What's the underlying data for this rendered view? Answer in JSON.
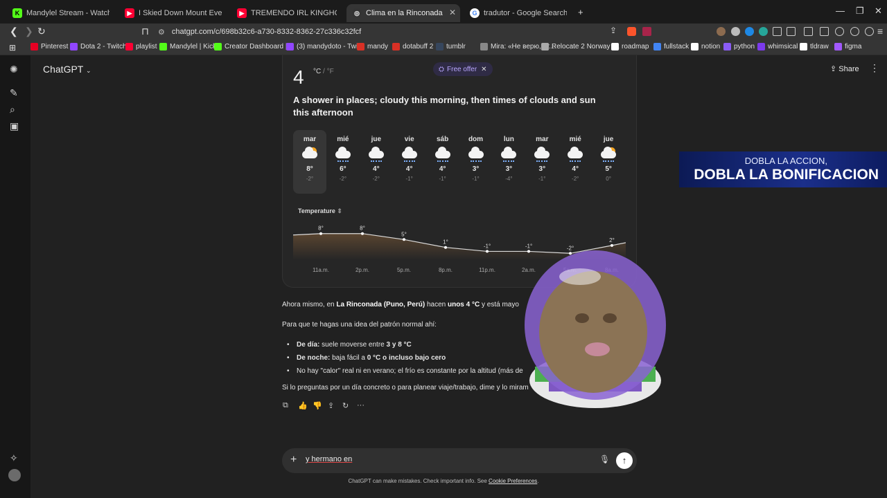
{
  "browser": {
    "tabs": [
      {
        "title": "Mandylel Stream - Watch Live on Kick",
        "color": "#53fc18",
        "letter": "K"
      },
      {
        "title": "I Skied Down Mount Everest (world f...",
        "color": "#ff0033",
        "letter": "▶"
      },
      {
        "title": "TREMENDO IRL KINGHOUSE en...",
        "color": "#ff0033",
        "letter": "▶"
      },
      {
        "title": "Clima en la Rinconada",
        "color": "#ffffff",
        "letter": "◎"
      },
      {
        "title": "tradutor - Google Search",
        "color": "#4285f4",
        "letter": "G"
      }
    ],
    "new_tab": "+",
    "url": "chatgpt.com/c/698b32c6-a730-8332-8362-27c336c32fcf",
    "bookmarks": [
      {
        "label": "Pinterest",
        "color": "#e60023"
      },
      {
        "label": "Dota 2 - Twitch",
        "color": "#9146ff"
      },
      {
        "label": "playlist",
        "color": "#ff0033"
      },
      {
        "label": "Mandylel | Kick",
        "color": "#53fc18"
      },
      {
        "label": "Creator Dashboard |...",
        "color": "#53fc18"
      },
      {
        "label": "(3) mandydoto - Twi...",
        "color": "#9146ff"
      },
      {
        "label": "mandy",
        "color": "#d93025"
      },
      {
        "label": "dotabuff 2",
        "color": "#d93025"
      },
      {
        "label": "tumblr",
        "color": "#36465d"
      },
      {
        "label": "Mira: «Не верю, чт...",
        "color": "#888888"
      },
      {
        "label": "Relocate 2 Norway |...",
        "color": "#aaaaaa"
      },
      {
        "label": "roadmap",
        "color": "#ffffff"
      },
      {
        "label": "fullstack",
        "color": "#4285f4"
      },
      {
        "label": "notion",
        "color": "#ffffff"
      },
      {
        "label": "python",
        "color": "#8a5cf6"
      },
      {
        "label": "whimsical",
        "color": "#7c3aed"
      },
      {
        "label": "tldraw",
        "color": "#ffffff"
      },
      {
        "label": "figma",
        "color": "#a259ff"
      }
    ]
  },
  "app": {
    "title": "ChatGPT",
    "free_offer": "Free offer",
    "share": "Share"
  },
  "weather": {
    "current_temp": "4",
    "unit_c": "°C",
    "unit_sep": " / ",
    "unit_f": "°F",
    "description": "A shower in places; cloudy this morning, then times of clouds and sun this afternoon",
    "days": [
      {
        "name": "mar",
        "hi": "8°",
        "lo": "-2°",
        "icon": "partly-cloudy-icon"
      },
      {
        "name": "mié",
        "hi": "6°",
        "lo": "-2°",
        "icon": "snow-cloud-icon"
      },
      {
        "name": "jue",
        "hi": "4°",
        "lo": "-2°",
        "icon": "snow-cloud-icon"
      },
      {
        "name": "vie",
        "hi": "4°",
        "lo": "-1°",
        "icon": "snow-cloud-icon"
      },
      {
        "name": "sáb",
        "hi": "4°",
        "lo": "-1°",
        "icon": "snow-cloud-icon"
      },
      {
        "name": "dom",
        "hi": "3°",
        "lo": "-1°",
        "icon": "snow-cloud-icon"
      },
      {
        "name": "lun",
        "hi": "3°",
        "lo": "-4°",
        "icon": "snow-cloud-icon"
      },
      {
        "name": "mar",
        "hi": "3°",
        "lo": "-1°",
        "icon": "snow-cloud-icon"
      },
      {
        "name": "mié",
        "hi": "4°",
        "lo": "-2°",
        "icon": "snow-cloud-icon"
      },
      {
        "name": "jue",
        "hi": "5°",
        "lo": "0°",
        "icon": "sun-shower-icon"
      }
    ],
    "temperature_label": "Temperature"
  },
  "chart_data": {
    "type": "area",
    "x": [
      "11a.m.",
      "2p.m.",
      "5p.m.",
      "8p.m.",
      "11p.m.",
      "2a.m.",
      "5a.m.",
      "8a.m."
    ],
    "values": [
      8,
      8,
      5,
      1,
      -1,
      -1,
      -2,
      2
    ],
    "labels": [
      "8°",
      "8°",
      "5°",
      "1°",
      "-1°",
      "-1°",
      "-2°",
      "2°"
    ],
    "ylim": [
      -4,
      10
    ]
  },
  "message": {
    "p1_a": "Ahora mismo, en ",
    "p1_b": "La Rinconada (Puno, Perú)",
    "p1_c": " hacen ",
    "p1_d": "unos 4 °C",
    "p1_e": " y está mayo",
    "p2": "Para que te hagas una idea del patrón normal ahí:",
    "b1_bold": "De día:",
    "b1_text": " suele moverse entre ",
    "b1_range": "3 y 8 °C",
    "b2_bold": "De noche:",
    "b2_text": " baja fácil a ",
    "b2_range": "0 °C o incluso bajo cero",
    "b3": "No hay \"calor\" real ni en verano; el frío es constante por la altitud (más de",
    "p3": "Si lo preguntas por un día concreto o para planear viaje/trabajo, dime y lo miram"
  },
  "composer": {
    "value": "y hermano en",
    "disclaimer": "ChatGPT can make mistakes. Check important info. See ",
    "disclaimer_link": "Cookie Preferences",
    "disclaimer_end": "."
  },
  "overlay": {
    "promo_line1": "DOBLA LA ACCION,",
    "promo_line2": "DOBLA LA BONIFICACION"
  }
}
